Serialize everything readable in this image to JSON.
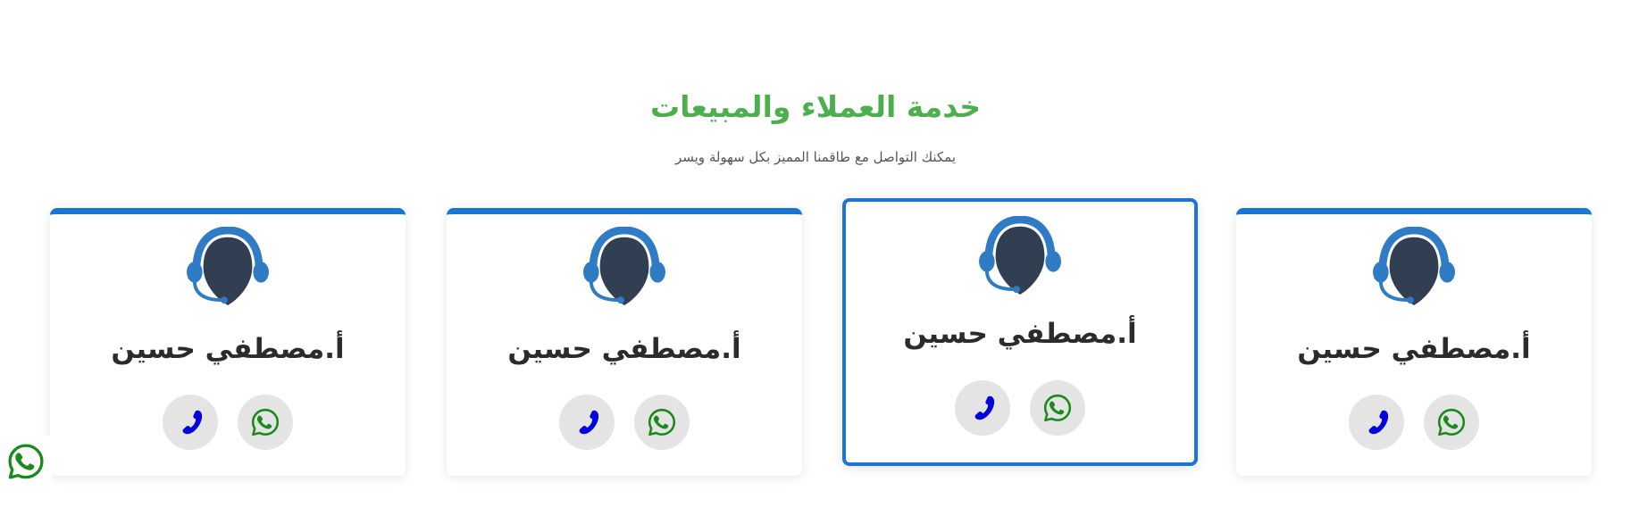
{
  "section": {
    "title": "خدمة العملاء والمبيعات",
    "subtitle": "يمكنك التواصل مع طاقمنا المميز بكل سهولة ويسر"
  },
  "colors": {
    "title_green": "#4cae4c",
    "accent_blue": "#1c74d3",
    "phone_icon": "#0000e0",
    "whatsapp_icon": "#1a8a1a",
    "button_bg": "#e4e4e4"
  },
  "agents": [
    {
      "name": "أ.مصطفي حسين",
      "avatar_icon": "headset-agent-icon",
      "whatsapp_icon": "whatsapp-icon",
      "phone_icon": "phone-icon",
      "highlighted": false
    },
    {
      "name": "أ.مصطفي حسين",
      "avatar_icon": "headset-agent-icon",
      "whatsapp_icon": "whatsapp-icon",
      "phone_icon": "phone-icon",
      "highlighted": true
    },
    {
      "name": "أ.مصطفي حسين",
      "avatar_icon": "headset-agent-icon",
      "whatsapp_icon": "whatsapp-icon",
      "phone_icon": "phone-icon",
      "highlighted": false
    },
    {
      "name": "أ.مصطفي حسين",
      "avatar_icon": "headset-agent-icon",
      "whatsapp_icon": "whatsapp-icon",
      "phone_icon": "phone-icon",
      "highlighted": false
    }
  ],
  "floating_button": {
    "icon": "whatsapp-icon"
  }
}
